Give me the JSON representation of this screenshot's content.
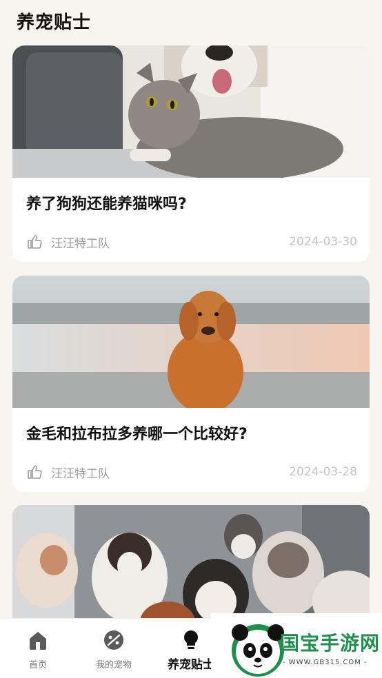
{
  "page": {
    "title": "养宠贴士"
  },
  "articles": [
    {
      "title": "养了狗狗还能养猫咪吗?",
      "author": "汪汪特工队",
      "date": "2024-03-30",
      "image": "cat-and-dog-photo"
    },
    {
      "title": "金毛和拉布拉多养哪一个比较好?",
      "author": "汪汪特工队",
      "date": "2024-03-28",
      "image": "golden-retriever-beach-photo"
    },
    {
      "image": "puppies-photo"
    }
  ],
  "tabbar": {
    "items": [
      {
        "label": "首页",
        "icon": "home-icon",
        "active": false
      },
      {
        "label": "我的宠物",
        "icon": "pet-icon",
        "active": false
      },
      {
        "label": "养宠贴士",
        "icon": "lightbulb-icon",
        "active": true
      }
    ]
  },
  "watermark": {
    "brand": "国宝手游网",
    "url": "- WWW.GB315.COM -"
  },
  "colors": {
    "background": "#f8f4ef",
    "accent": "#111111",
    "watermark_green": "#1f8f4d"
  }
}
